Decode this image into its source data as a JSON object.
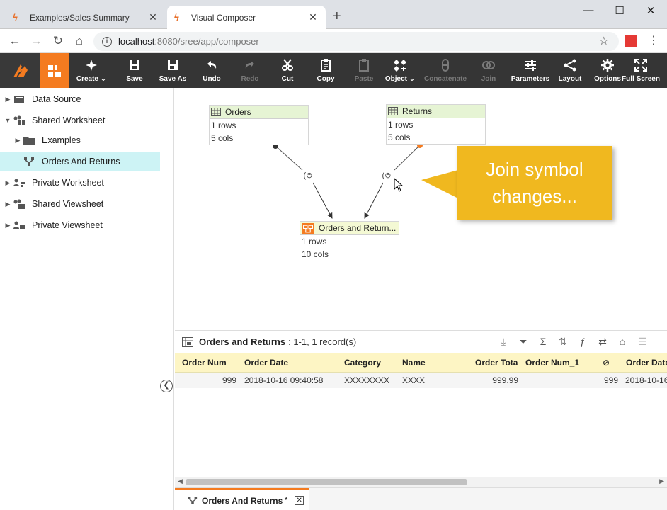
{
  "browser": {
    "tabs": [
      {
        "label": "Examples/Sales Summary",
        "active": false
      },
      {
        "label": "Visual Composer",
        "active": true
      }
    ],
    "url_host": "localhost",
    "url_path": ":8080/sree/app/composer"
  },
  "toolbar": {
    "buttons": [
      {
        "label": "Create",
        "enabled": true
      },
      {
        "label": "Save",
        "enabled": true
      },
      {
        "label": "Save As",
        "enabled": true
      },
      {
        "label": "Undo",
        "enabled": true
      },
      {
        "label": "Redo",
        "enabled": false
      },
      {
        "label": "Cut",
        "enabled": true
      },
      {
        "label": "Copy",
        "enabled": true
      },
      {
        "label": "Paste",
        "enabled": false
      },
      {
        "label": "Object",
        "enabled": true
      },
      {
        "label": "Concatenate",
        "enabled": false
      },
      {
        "label": "Join",
        "enabled": false
      },
      {
        "label": "Parameters",
        "enabled": true
      },
      {
        "label": "Layout",
        "enabled": true
      },
      {
        "label": "Options",
        "enabled": true
      },
      {
        "label": "Full Screen",
        "enabled": true
      }
    ]
  },
  "tree": {
    "items": [
      {
        "label": "Data Source",
        "level": 0,
        "expanded": false
      },
      {
        "label": "Shared Worksheet",
        "level": 0,
        "expanded": true
      },
      {
        "label": "Examples",
        "level": 1,
        "expanded": false
      },
      {
        "label": "Orders And Returns",
        "level": 1,
        "selected": true
      },
      {
        "label": "Private Worksheet",
        "level": 0,
        "expanded": false
      },
      {
        "label": "Shared Viewsheet",
        "level": 0,
        "expanded": false
      },
      {
        "label": "Private Viewsheet",
        "level": 0,
        "expanded": false
      }
    ]
  },
  "canvas": {
    "orders": {
      "title": "Orders",
      "rows": "1 rows",
      "cols": "5 cols"
    },
    "returns": {
      "title": "Returns",
      "rows": "1 rows",
      "cols": "5 cols"
    },
    "joined": {
      "title": "Orders and Return...",
      "rows": "1 rows",
      "cols": "10 cols"
    },
    "callout_text": "Join symbol changes..."
  },
  "grid": {
    "title": "Orders and Returns",
    "subtitle": ": 1-1, 1 record(s)",
    "columns": [
      "Order Num",
      "Order Date",
      "Category",
      "Name",
      "Order Tota",
      "Order Num_1",
      "",
      "Order Date"
    ],
    "row": [
      "999",
      "2018-10-16 09:40:58",
      "XXXXXXXX",
      "XXXX",
      "999.99",
      "",
      "999",
      "2018-10-16"
    ]
  },
  "bottom_tab": {
    "label": "Orders And Returns",
    "modified_marker": "*"
  },
  "colors": {
    "accent": "#f47b20",
    "toolbar": "#353535",
    "selected": "#cdf3f5",
    "callout": "#f0b81f"
  }
}
